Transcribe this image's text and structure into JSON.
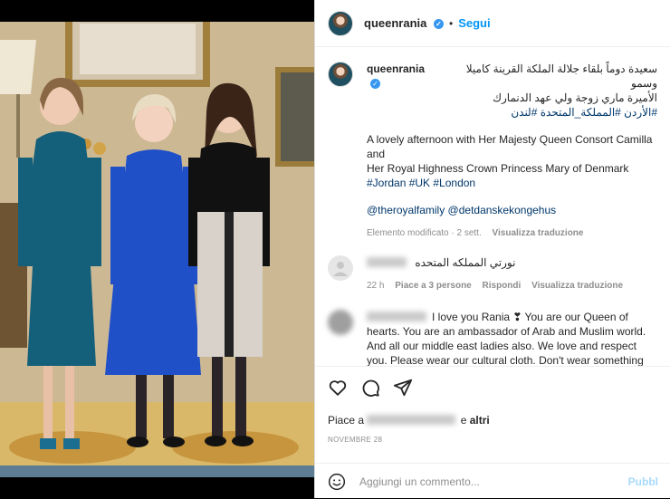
{
  "header": {
    "username": "queenrania",
    "dot": "•",
    "follow_label": "Segui"
  },
  "caption": {
    "username": "queenrania",
    "arabic_line1": "سعيدة دوماً بلقاء جلالة الملكة القرينة كاميلا وسمو",
    "arabic_line2": "الأميرة ماري زوجة ولي عهد الدنمارك",
    "arabic_tags": "#الأردن #المملكة_المتحدة #لندن",
    "english_line1": "A lovely afternoon with Her Majesty Queen Consort Camilla and",
    "english_line2": "Her Royal Highness Crown Princess Mary of Denmark",
    "english_tags": "#Jordan #UK #London",
    "mentions": "@theroyalfamily @detdanskekongehus",
    "meta_edited": "Elemento modificato · 2 sett.",
    "meta_translate": "Visualizza traduzione"
  },
  "comments": [
    {
      "text": "نورتي المملكه المتحده",
      "time": "22 h",
      "likes": "Piace a 3 persone",
      "reply": "Rispondi",
      "translate": "Visualizza traduzione"
    },
    {
      "text": "I love you Rania ❣ You are our Queen of hearts. You are an ambassador of Arab and Muslim world. And all our middle east ladies also. We love and respect you. Please wear our cultural cloth. Don't wear something that inappropriate and disrespect our culture. Humble request to you for this."
    }
  ],
  "likes": {
    "prefix": "Piace a",
    "suffix": "e",
    "others": "altri"
  },
  "date": "NOVEMBRE 28",
  "add_comment": {
    "placeholder": "Aggiungi un commento...",
    "publish_label": "Pubbl"
  },
  "icons": [
    "heart-icon",
    "comment-icon",
    "share-icon",
    "emoji-icon",
    "verified-icon",
    "user-icon"
  ],
  "colors": {
    "accent": "#0095f6",
    "verified": "#3797f0",
    "text": "#262626",
    "muted": "#8e8e8e",
    "hashtag": "#00376b"
  }
}
